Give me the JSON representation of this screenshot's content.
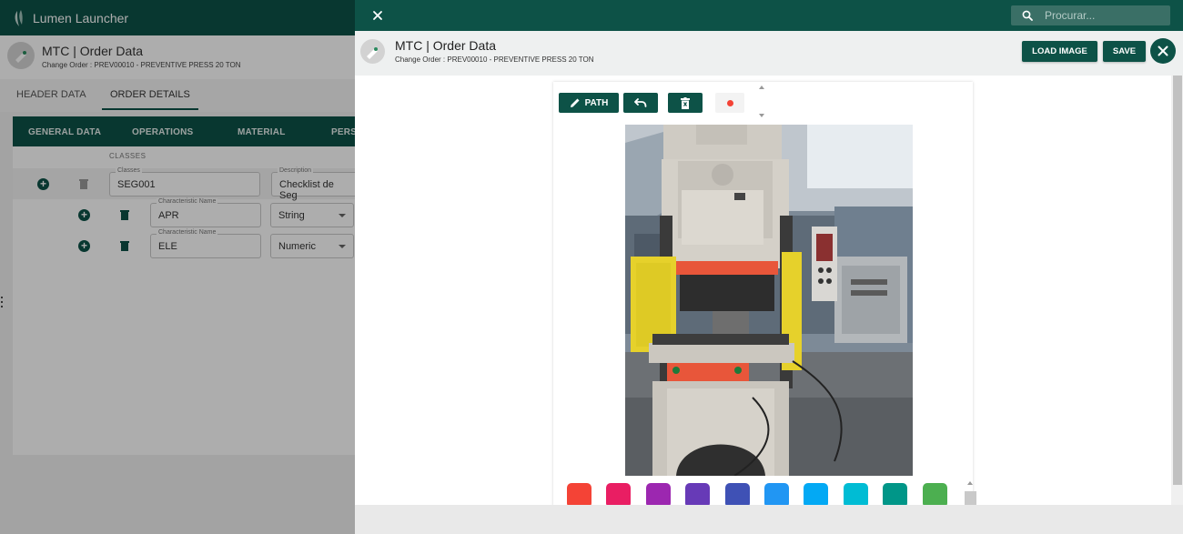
{
  "background_app": {
    "launcher_title": "Lumen Launcher",
    "page_title": "MTC | Order Data",
    "page_subtitle": "Change Order : PREV00010 - PREVENTIVE PRESS 20 TON",
    "tabs": [
      {
        "label": "HEADER DATA",
        "active": false
      },
      {
        "label": "ORDER DETAILS",
        "active": true
      }
    ],
    "subtabs": [
      "GENERAL DATA",
      "OPERATIONS",
      "MATERIAL",
      "PERS"
    ],
    "classes_header": "CLASSES",
    "class_row": {
      "class_label": "Classes",
      "class_value": "SEG001",
      "desc_label": "Description",
      "desc_value": "Checklist de Seg"
    },
    "characteristics": [
      {
        "label": "Characteristic Name",
        "value": "APR",
        "type": "String"
      },
      {
        "label": "Characteristic Name",
        "value": "ELE",
        "type": "Numeric"
      }
    ]
  },
  "modal": {
    "search_placeholder": "Procurar...",
    "title": "MTC | Order Data",
    "subtitle": "Change Order : PREV00010 - PREVENTIVE PRESS 20 TON",
    "load_image_label": "LOAD IMAGE",
    "save_label": "SAVE",
    "toolbar": {
      "path_label": "PATH",
      "active_color": "#f44336"
    },
    "image_alt": "Photo of an industrial press machine",
    "palette": [
      "#f44336",
      "#e91e63",
      "#9c27b0",
      "#673ab7",
      "#3f51b5",
      "#2196f3",
      "#03a9f4",
      "#00bcd4",
      "#009688",
      "#4caf50"
    ]
  },
  "colors": {
    "primary": "#0d5247",
    "overlay": "rgba(0,0,0,0.32)"
  }
}
